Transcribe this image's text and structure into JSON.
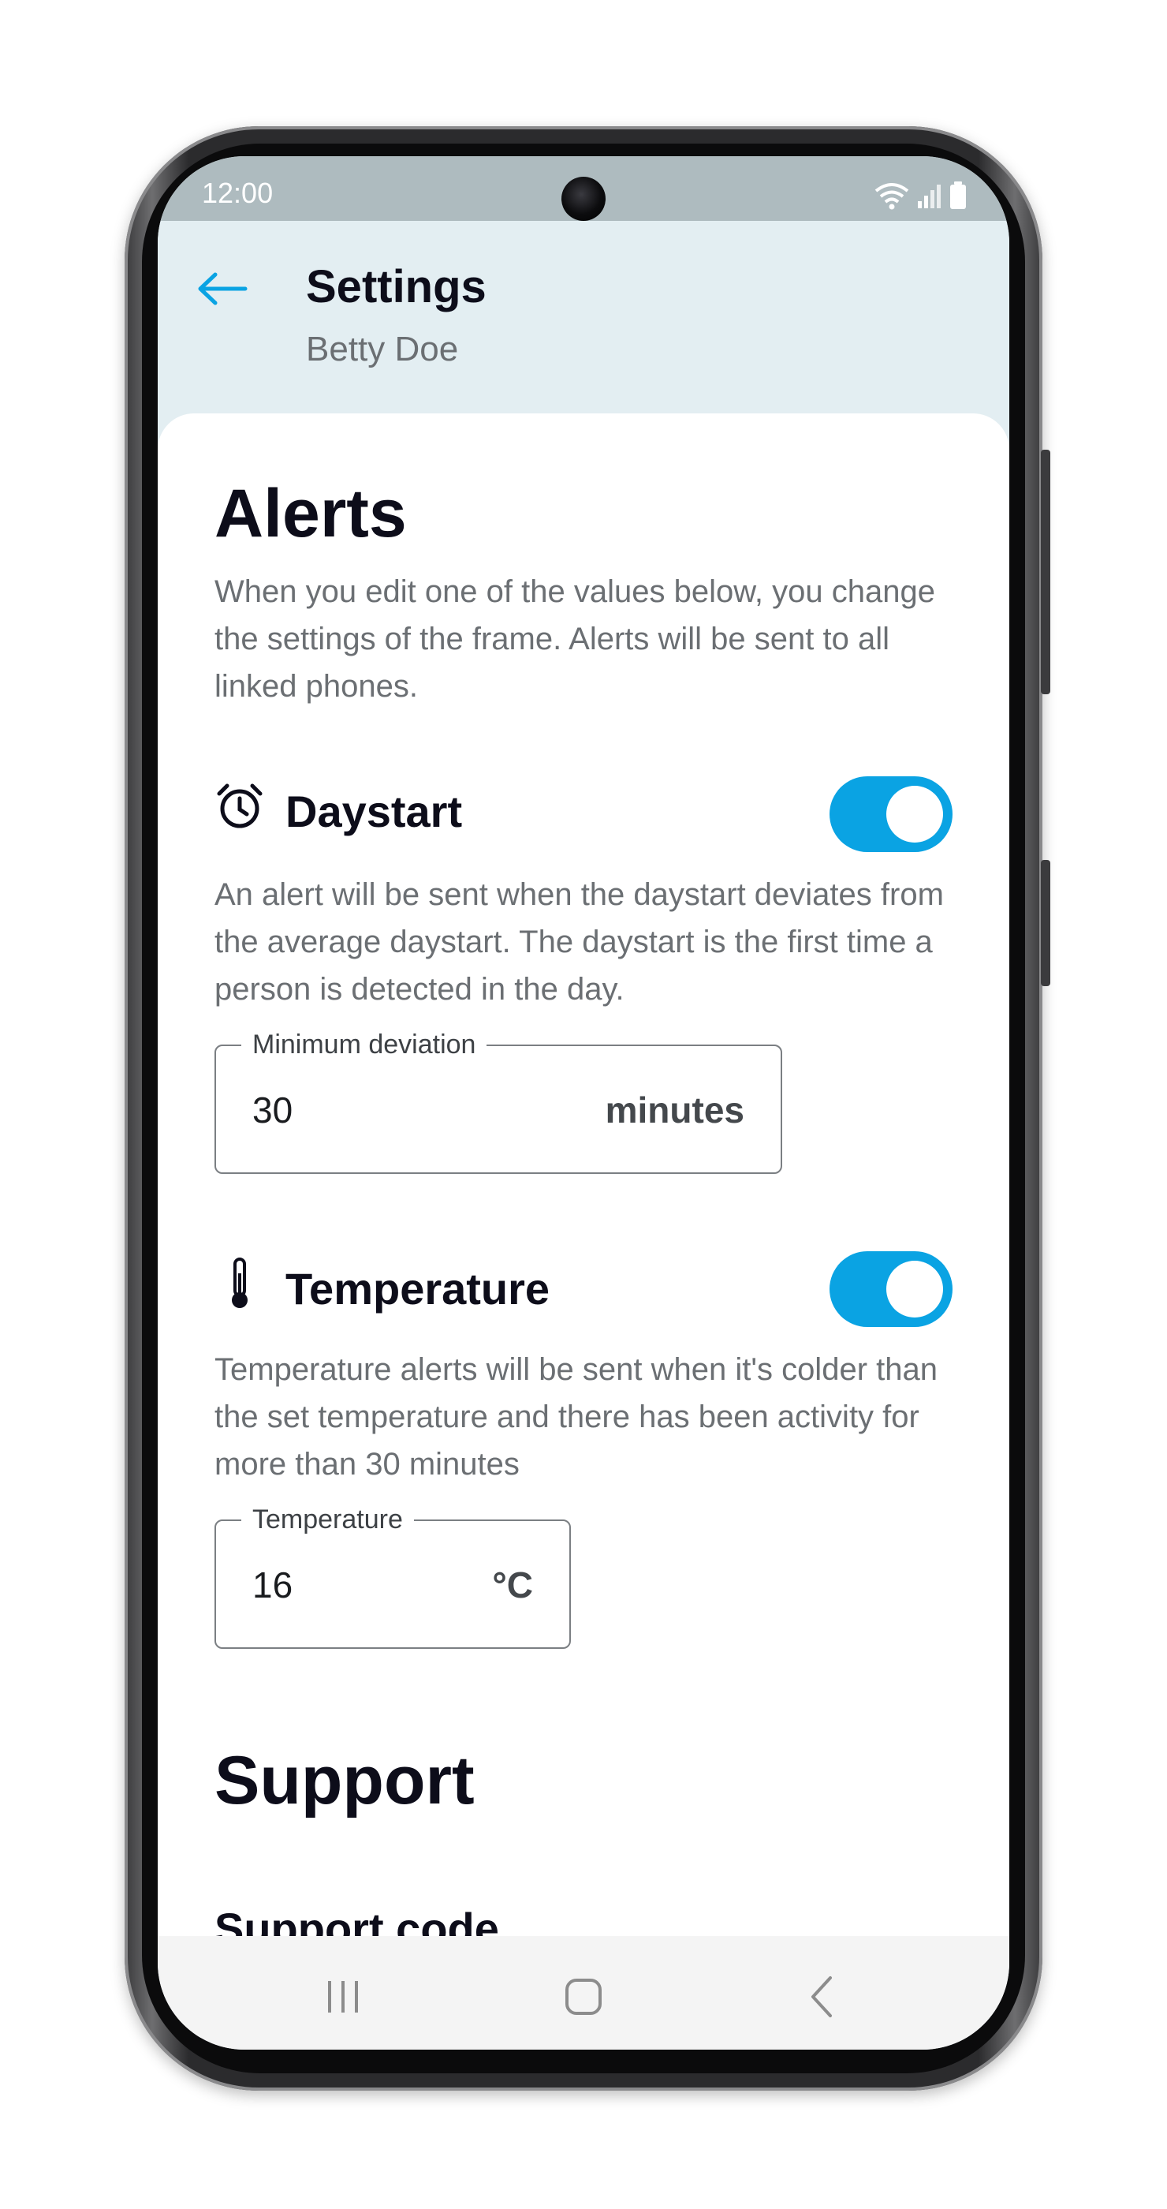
{
  "status": {
    "time": "12:00"
  },
  "appbar": {
    "title": "Settings",
    "subtitle": "Betty Doe"
  },
  "alerts": {
    "heading": "Alerts",
    "description": "When you edit one of the values below, you change the settings of the frame. Alerts will be sent to all linked phones.",
    "daystart": {
      "title": "Daystart",
      "icon": "alarm-clock-icon",
      "enabled": true,
      "description": "An alert will be sent when the daystart deviates from the average daystart. The daystart is the first time a person is detected in the day.",
      "field_label": "Minimum deviation",
      "field_value": "30",
      "field_unit": "minutes"
    },
    "temperature": {
      "title": "Temperature",
      "icon": "thermometer-icon",
      "enabled": true,
      "description": "Temperature alerts will be sent when it's colder than the set temperature and there has been activity for more than 30 minutes",
      "field_label": "Temperature",
      "field_value": "16",
      "field_unit": "°C"
    }
  },
  "support": {
    "heading": "Support",
    "support_code_label": "Support code"
  },
  "colors": {
    "accent": "#0aa3e3",
    "appbar_bg": "#e3eef2",
    "statusbar_bg": "#aebbbf"
  }
}
